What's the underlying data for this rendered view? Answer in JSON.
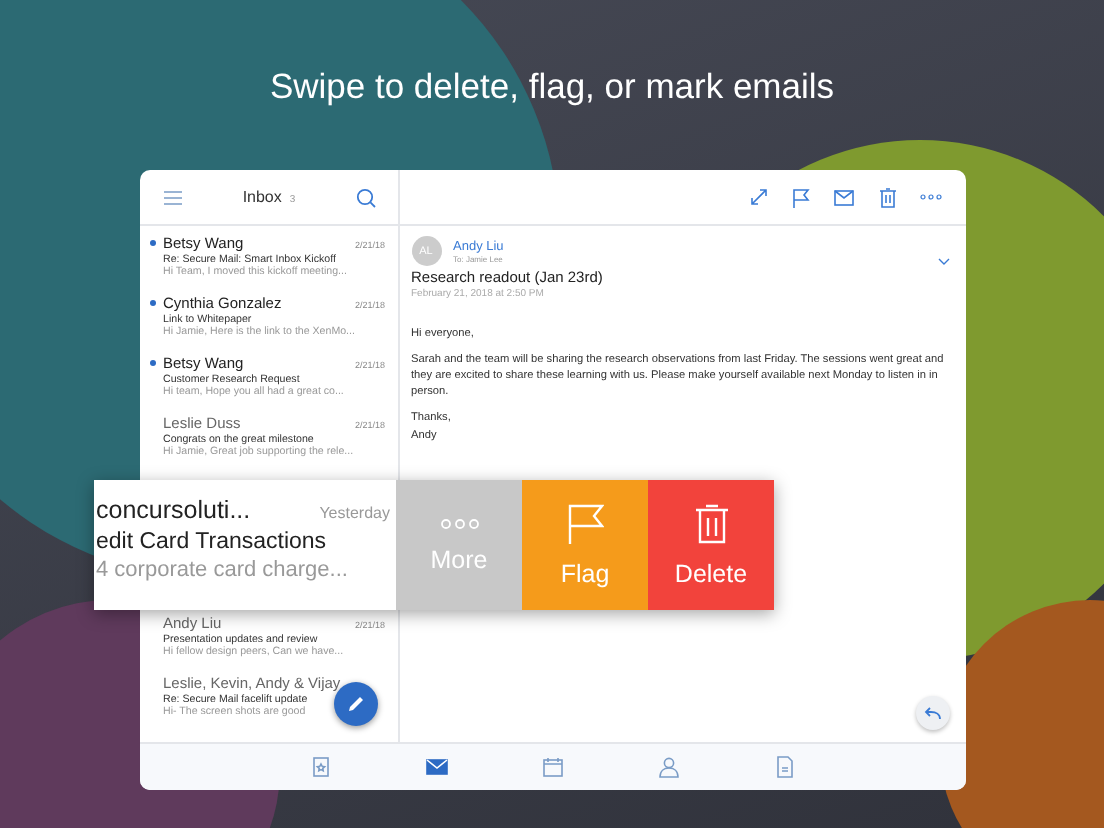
{
  "headline": "Swipe to delete, flag, or mark emails",
  "inbox": {
    "title": "Inbox",
    "count": "3",
    "messages": [
      {
        "sender": "Betsy Wang",
        "date": "2/21/18",
        "subject": "Re: Secure Mail: Smart Inbox Kickoff",
        "preview": "Hi Team,    I moved this kickoff meeting...",
        "unread": true
      },
      {
        "sender": "Cynthia Gonzalez",
        "date": "2/21/18",
        "subject": "Link to Whitepaper",
        "preview": "Hi Jamie,  Here is the link to the XenMo...",
        "unread": true
      },
      {
        "sender": "Betsy Wang",
        "date": "2/21/18",
        "subject": "Customer Research Request",
        "preview": "Hi team,    Hope you all had a great co...",
        "unread": true
      },
      {
        "sender": "Leslie Duss",
        "date": "2/21/18",
        "subject": "Congrats on the great milestone",
        "preview": "Hi Jamie, Great job supporting the rele...",
        "unread": false
      },
      {
        "sender": "Andy Liu",
        "date": "2/21/18",
        "subject": "Presentation updates and review",
        "preview": "Hi fellow design peers,    Can we have...",
        "unread": false
      },
      {
        "sender": "Leslie, Kevin, Andy & Vijay",
        "subject": "Re: Secure Mail facelift update",
        "preview": "Hi- The screen shots are good",
        "unread": false
      }
    ]
  },
  "swiped": {
    "sender": "concursoluti...",
    "date": "Yesterday",
    "subject": "edit Card Transactions",
    "preview": "4 corporate card charge...",
    "actions": [
      {
        "kind": "more",
        "label": "More"
      },
      {
        "kind": "flag",
        "label": "Flag"
      },
      {
        "kind": "delete",
        "label": "Delete"
      }
    ]
  },
  "reader": {
    "initials": "AL",
    "sender": "Andy Liu",
    "to": "To: Jamie Lee",
    "subject": "Research readout (Jan 23rd)",
    "date": "February 21, 2018 at 2:50 PM",
    "body": [
      "Hi everyone,",
      "Sarah and the team will be sharing the research observations from last Friday. The sessions went great and they are excited to share these learning with us. Please make yourself available next Monday to listen in in person."
    ],
    "signoff": [
      "Thanks,",
      "Andy"
    ]
  },
  "tabs": [
    {
      "kind": "today",
      "selected": false
    },
    {
      "kind": "mail",
      "selected": true
    },
    {
      "kind": "calendar",
      "selected": false
    },
    {
      "kind": "contacts",
      "selected": false
    },
    {
      "kind": "files",
      "selected": false
    }
  ]
}
